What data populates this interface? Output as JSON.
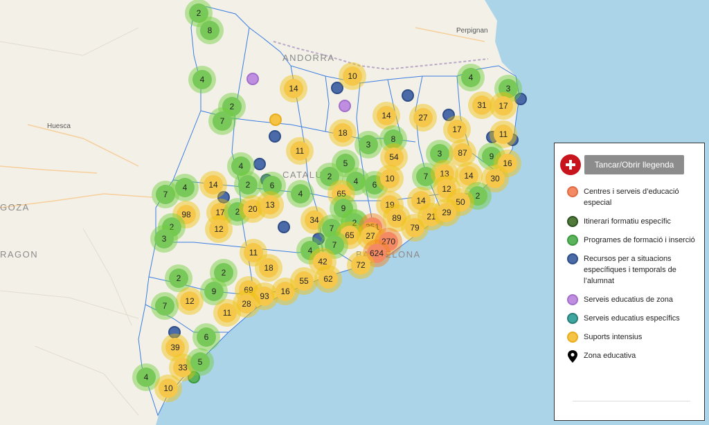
{
  "map": {
    "place_labels": [
      {
        "name": "andorra",
        "text": "ANDORRA"
      },
      {
        "name": "perpignan",
        "text": "Perpignan"
      },
      {
        "name": "huesca",
        "text": "Huesca"
      },
      {
        "name": "zaragoza",
        "text": "GOZA"
      },
      {
        "name": "aragon",
        "text": "RAGON"
      },
      {
        "name": "catalunya",
        "text": "CATALU"
      },
      {
        "name": "barcelona",
        "text": "BARCELONA"
      }
    ],
    "clusters": [
      {
        "count": "2",
        "color": "green"
      },
      {
        "count": "8",
        "color": "green"
      },
      {
        "count": "4",
        "color": "green"
      },
      {
        "count": "2",
        "color": "green"
      },
      {
        "count": "7",
        "color": "green"
      },
      {
        "count": "14",
        "color": "yellow"
      },
      {
        "count": "10",
        "color": "yellow"
      },
      {
        "count": "4",
        "color": "green"
      },
      {
        "count": "3",
        "color": "green"
      },
      {
        "count": "31",
        "color": "yellow"
      },
      {
        "count": "17",
        "color": "yellow"
      },
      {
        "count": "14",
        "color": "yellow"
      },
      {
        "count": "27",
        "color": "yellow"
      },
      {
        "count": "17",
        "color": "yellow"
      },
      {
        "count": "18",
        "color": "yellow"
      },
      {
        "count": "11",
        "color": "yellow"
      },
      {
        "count": "11",
        "color": "yellow"
      },
      {
        "count": "3",
        "color": "green"
      },
      {
        "count": "8",
        "color": "green"
      },
      {
        "count": "54",
        "color": "yellow"
      },
      {
        "count": "3",
        "color": "green"
      },
      {
        "count": "87",
        "color": "yellow"
      },
      {
        "count": "9",
        "color": "green"
      },
      {
        "count": "16",
        "color": "yellow"
      },
      {
        "count": "4",
        "color": "green"
      },
      {
        "count": "5",
        "color": "green"
      },
      {
        "count": "2",
        "color": "green"
      },
      {
        "count": "4",
        "color": "green"
      },
      {
        "count": "6",
        "color": "green"
      },
      {
        "count": "10",
        "color": "yellow"
      },
      {
        "count": "7",
        "color": "green"
      },
      {
        "count": "13",
        "color": "yellow"
      },
      {
        "count": "14",
        "color": "yellow"
      },
      {
        "count": "30",
        "color": "yellow"
      },
      {
        "count": "7",
        "color": "green"
      },
      {
        "count": "4",
        "color": "green"
      },
      {
        "count": "14",
        "color": "yellow"
      },
      {
        "count": "2",
        "color": "green"
      },
      {
        "count": "6",
        "color": "green"
      },
      {
        "count": "4",
        "color": "green"
      },
      {
        "count": "65",
        "color": "yellow"
      },
      {
        "count": "12",
        "color": "yellow"
      },
      {
        "count": "2",
        "color": "green"
      },
      {
        "count": "98",
        "color": "yellow"
      },
      {
        "count": "17",
        "color": "yellow"
      },
      {
        "count": "2",
        "color": "green"
      },
      {
        "count": "20",
        "color": "yellow"
      },
      {
        "count": "13",
        "color": "yellow"
      },
      {
        "count": "9",
        "color": "green"
      },
      {
        "count": "19",
        "color": "yellow"
      },
      {
        "count": "14",
        "color": "yellow"
      },
      {
        "count": "50",
        "color": "yellow"
      },
      {
        "count": "2",
        "color": "green"
      },
      {
        "count": "2",
        "color": "green"
      },
      {
        "count": "3",
        "color": "green"
      },
      {
        "count": "12",
        "color": "yellow"
      },
      {
        "count": "34",
        "color": "yellow"
      },
      {
        "count": "7",
        "color": "green"
      },
      {
        "count": "2",
        "color": "green"
      },
      {
        "count": "351",
        "color": "orange"
      },
      {
        "count": "89",
        "color": "yellow"
      },
      {
        "count": "79",
        "color": "yellow"
      },
      {
        "count": "21",
        "color": "yellow"
      },
      {
        "count": "29",
        "color": "yellow"
      },
      {
        "count": "65",
        "color": "yellow"
      },
      {
        "count": "27",
        "color": "yellow"
      },
      {
        "count": "270",
        "color": "orange"
      },
      {
        "count": "11",
        "color": "yellow"
      },
      {
        "count": "4",
        "color": "green"
      },
      {
        "count": "7",
        "color": "green"
      },
      {
        "count": "624",
        "color": "orange"
      },
      {
        "count": "42",
        "color": "yellow"
      },
      {
        "count": "18",
        "color": "yellow"
      },
      {
        "count": "72",
        "color": "yellow"
      },
      {
        "count": "2",
        "color": "green"
      },
      {
        "count": "2",
        "color": "green"
      },
      {
        "count": "9",
        "color": "green"
      },
      {
        "count": "69",
        "color": "yellow"
      },
      {
        "count": "93",
        "color": "yellow"
      },
      {
        "count": "16",
        "color": "yellow"
      },
      {
        "count": "55",
        "color": "yellow"
      },
      {
        "count": "62",
        "color": "yellow"
      },
      {
        "count": "12",
        "color": "yellow"
      },
      {
        "count": "28",
        "color": "yellow"
      },
      {
        "count": "7",
        "color": "green"
      },
      {
        "count": "11",
        "color": "yellow"
      },
      {
        "count": "6",
        "color": "green"
      },
      {
        "count": "39",
        "color": "yellow"
      },
      {
        "count": "33",
        "color": "yellow"
      },
      {
        "count": "5",
        "color": "green"
      },
      {
        "count": "4",
        "color": "green"
      },
      {
        "count": "10",
        "color": "yellow"
      }
    ]
  },
  "legend": {
    "toggle_label": "Tancar/Obrir llegenda",
    "items": [
      {
        "label": "Centres i serveis d’educació especial",
        "color": "#f48a63",
        "border": "#e06a43"
      },
      {
        "label": "Itinerari formatiu específic",
        "color": "#4f7a3a",
        "border": "#2e5020"
      },
      {
        "label": "Programes de formació i inserció",
        "color": "#5bb45b",
        "border": "#3d9940"
      },
      {
        "label": "Recursos per a situacions específiques i temporals de l’alumnat",
        "color": "#4a6aa8",
        "border": "#2f4e88"
      },
      {
        "label": "Serveis educatius de zona",
        "color": "#c08ee0",
        "border": "#a26fcb"
      },
      {
        "label": "Serveis educatius específics",
        "color": "#3ea6a0",
        "border": "#2b7d78"
      },
      {
        "label": "Suports intensius",
        "color": "#f5c444",
        "border": "#e8ac1c"
      },
      {
        "label": "Zona educativa",
        "icon": "map-pin-icon"
      }
    ]
  }
}
